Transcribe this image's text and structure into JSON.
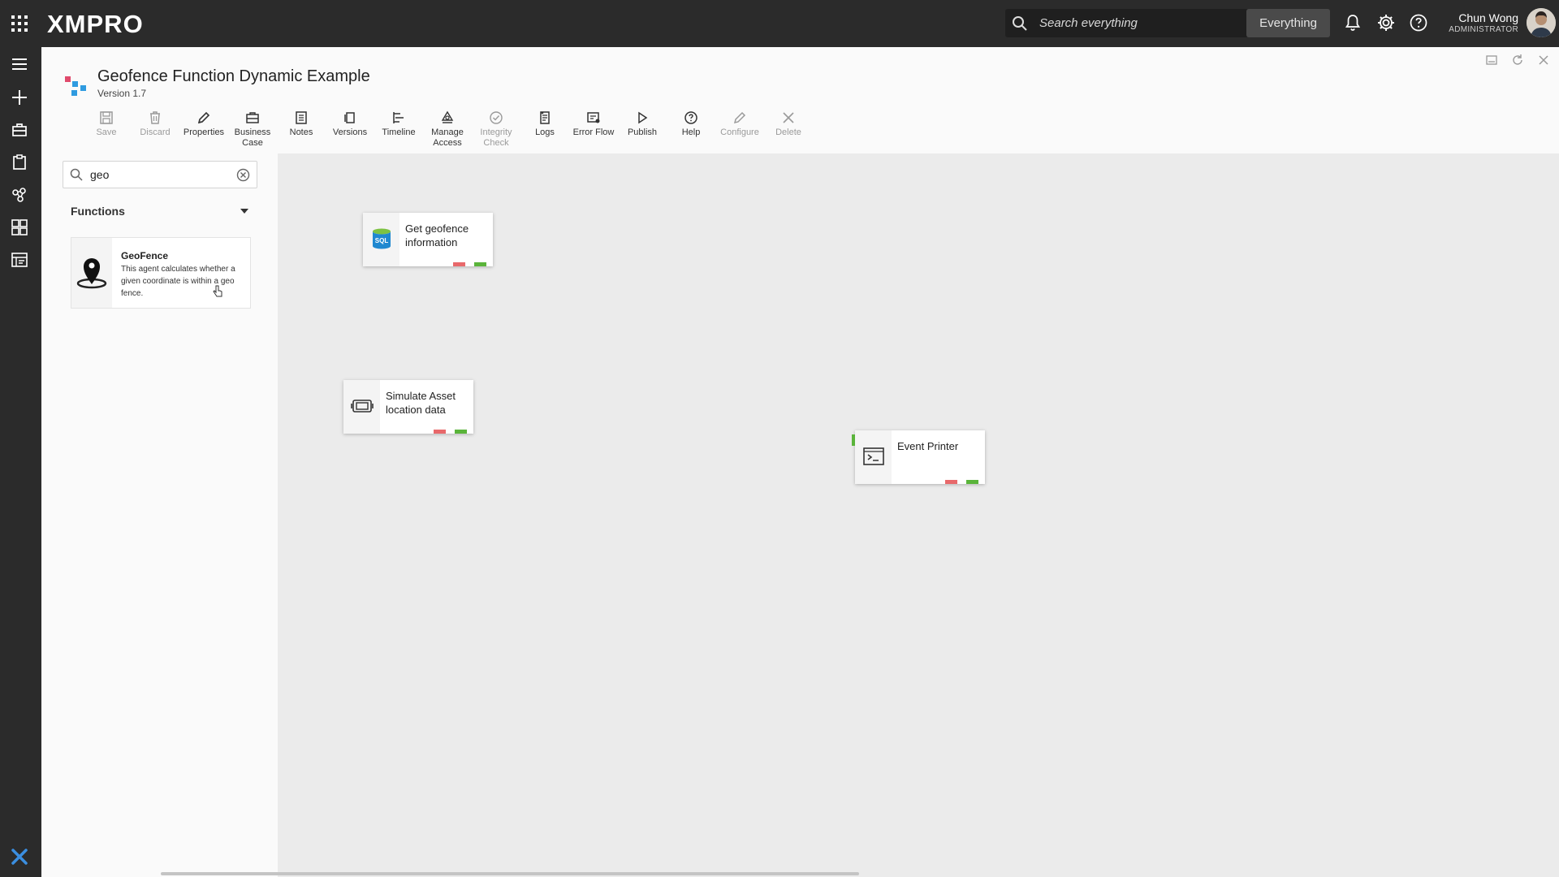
{
  "topbar": {
    "brand": "XMPRO",
    "search_placeholder": "Search everything",
    "search_scope": "Everything",
    "user_name": "Chun Wong",
    "user_role": "ADMINISTRATOR"
  },
  "header": {
    "title": "Geofence Function Dynamic Example",
    "version": "Version 1.7"
  },
  "toolbar": [
    {
      "label": "Save",
      "icon": "save-icon",
      "enabled": false
    },
    {
      "label": "Discard",
      "icon": "trash-icon",
      "enabled": false
    },
    {
      "label": "Properties",
      "icon": "pencil-icon",
      "enabled": true
    },
    {
      "label": "Business Case",
      "icon": "briefcase-icon",
      "enabled": true
    },
    {
      "label": "Notes",
      "icon": "notes-icon",
      "enabled": true
    },
    {
      "label": "Versions",
      "icon": "versions-icon",
      "enabled": true
    },
    {
      "label": "Timeline",
      "icon": "timeline-icon",
      "enabled": true
    },
    {
      "label": "Manage Access",
      "icon": "access-icon",
      "enabled": true
    },
    {
      "label": "Integrity Check",
      "icon": "check-icon",
      "enabled": false
    },
    {
      "label": "Logs",
      "icon": "logs-icon",
      "enabled": true
    },
    {
      "label": "Error Flow",
      "icon": "error-flow-icon",
      "enabled": true
    },
    {
      "label": "Publish",
      "icon": "play-icon",
      "enabled": true
    },
    {
      "label": "Help",
      "icon": "help-icon",
      "enabled": true
    },
    {
      "label": "Configure",
      "icon": "pencil-icon",
      "enabled": false
    },
    {
      "label": "Delete",
      "icon": "close-icon",
      "enabled": false
    }
  ],
  "sidepanel": {
    "filter_value": "geo",
    "section": "Functions",
    "agent": {
      "name": "GeoFence",
      "description": "This agent calculates whether a given coordinate is within a geo fence."
    }
  },
  "canvas": {
    "nodes": [
      {
        "id": "get-geofence",
        "label": "Get geofence information",
        "icon": "sql-icon"
      },
      {
        "id": "simulate-asset",
        "label": "Simulate Asset location data",
        "icon": "simulator-icon"
      },
      {
        "id": "event-printer",
        "label": "Event Printer",
        "icon": "terminal-icon"
      }
    ]
  },
  "colors": {
    "topbar": "#2b2b2b",
    "port_output": "#5ab43a",
    "port_error": "#e8696b"
  }
}
